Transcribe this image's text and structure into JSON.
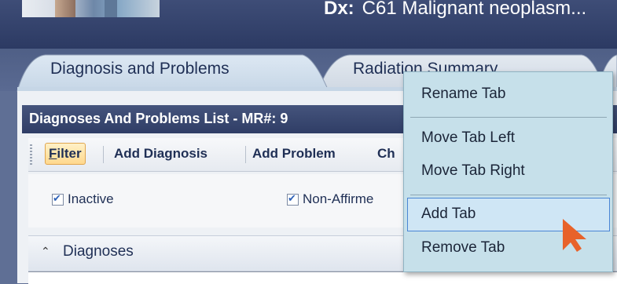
{
  "header": {
    "dx_label": "Dx:",
    "dx_value": "C61 Malignant neoplasm..."
  },
  "tabs": [
    {
      "label": "Diagnosis and Problems",
      "active": true
    },
    {
      "label": "Radiation Summary",
      "active": false
    }
  ],
  "panel": {
    "title": "Diagnoses And Problems List - MR#: 9"
  },
  "toolbar": {
    "filter_first_letter": "F",
    "filter_rest": "ilter",
    "add_diagnosis": "Add Diagnosis",
    "add_problem": "Add Problem",
    "partial": "Ch"
  },
  "options": {
    "inactive": "Inactive",
    "non_affirmed": "Non-Affirme"
  },
  "section": {
    "label": "Diagnoses"
  },
  "context_menu": {
    "items": [
      "Rename Tab",
      "Move Tab Left",
      "Move Tab Right",
      "Add Tab",
      "Remove Tab"
    ],
    "highlighted": "Add Tab"
  },
  "colors": {
    "header_bg": "#2c3a63",
    "menu_bg": "#c6e0ea",
    "highlight_border": "#4a85d5",
    "cursor": "#e8622a"
  }
}
